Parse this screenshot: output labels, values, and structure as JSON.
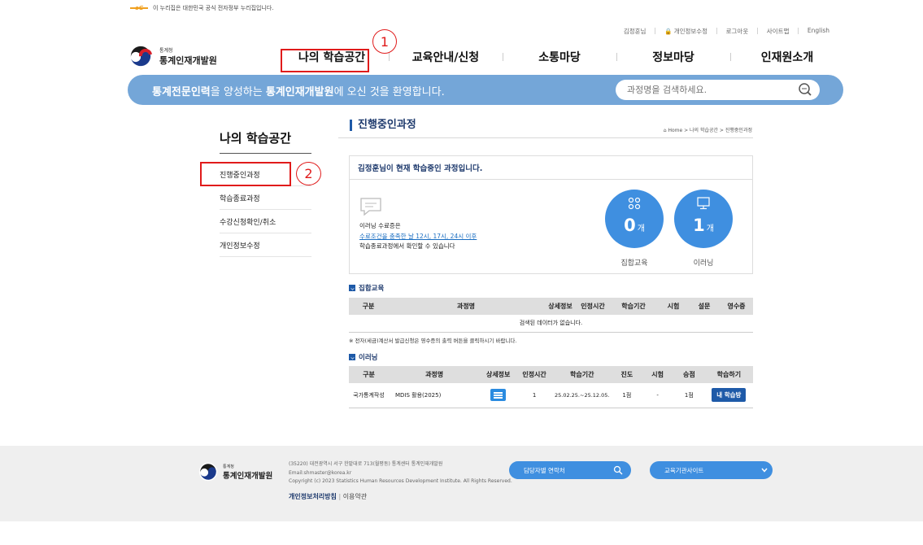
{
  "gov_notice": "이 누리집은 대한민국 공식 전자정부 누리집입니다.",
  "util_links": [
    "김정훈님",
    "개인정보수정",
    "로그아웃",
    "사이트맵",
    "English"
  ],
  "logo": {
    "small": "통계청",
    "big": "통계인재개발원"
  },
  "gnb": [
    "나의 학습공간",
    "교육안내/신청",
    "소통마당",
    "정보마당",
    "인재원소개"
  ],
  "annotations": [
    "1",
    "2"
  ],
  "banner": {
    "part1": "통계전문인력",
    "part2": "을 양성하는 ",
    "part3": "통계인재개발원",
    "part4": "에 오신 것을 환영합니다.",
    "search_placeholder": "과정명을 검색하세요."
  },
  "sidebar": {
    "title": "나의 학습공간",
    "items": [
      "진행중인과정",
      "학습종료과정",
      "수강신청확인/취소",
      "개인정보수정"
    ]
  },
  "page_title": "진행중인과정",
  "breadcrumb": "Home > 나의 학습공간 > 진행중인과정",
  "status": {
    "headline": "김정훈님이 현재 학습중인 과정입니다.",
    "note1": "이러닝 수료증은",
    "note2": "수료조건을 충족한 날 12시, 17시, 24시 이후",
    "note3": "학습종료과정에서 확인할 수 있습니다",
    "stats": [
      {
        "count": "0",
        "unit": "개",
        "label": "집합교육"
      },
      {
        "count": "1",
        "unit": "개",
        "label": "이러닝"
      }
    ]
  },
  "group": {
    "title": "집합교육",
    "headers": [
      "구분",
      "과정명",
      "상세정보",
      "인정시간",
      "학습기간",
      "시험",
      "설문",
      "영수증"
    ],
    "empty": "검색된 데이터가 없습니다."
  },
  "notice": "※ 전자(세금)계산서 발급신청은 영수증의 출력 버튼을 클릭하시기 바랍니다.",
  "elearning": {
    "title": "이러닝",
    "headers": [
      "구분",
      "과정명",
      "상세정보",
      "인정시간",
      "학습기간",
      "진도",
      "시험",
      "승점",
      "학습하기"
    ],
    "row": {
      "type": "국가통계작성",
      "course": "MDIS 활용(2025)",
      "hours": "1",
      "period": "25.02.25.~25.12.05.",
      "progress": "1점",
      "exam": "-",
      "score": "1점",
      "button": "내 학습방"
    }
  },
  "footer": {
    "logo_small": "통계청",
    "logo_big": "통계인재개발원",
    "address": "(35220) 대전광역시 서구 한밭대로 713(월평동) 통계센터 통계인재개발원",
    "email": "Email:shmaster@korea.kr",
    "copyright": "Copyright (c) 2023 Statistics Human Resources Development Institute. All Rights Reserved.",
    "privacy": "개인정보처리방침",
    "terms": "이용약관",
    "contact_pill": "담당자별 연락처",
    "sites_pill": "교육기관사이트"
  }
}
